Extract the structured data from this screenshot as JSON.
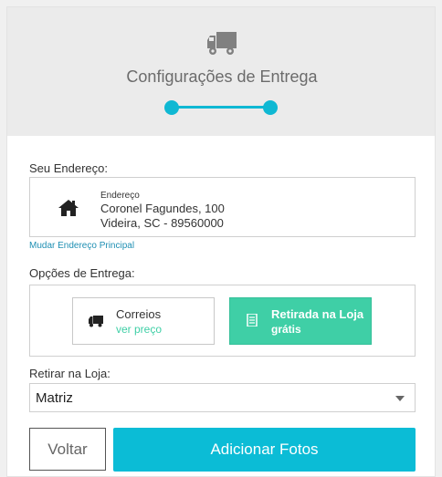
{
  "header": {
    "title": "Configurações de Entrega",
    "icon": "truck-icon",
    "step_color": "#0fb8d3"
  },
  "address": {
    "label": "Seu Endereço:",
    "caption": "Endereço",
    "line1": "Coronel Fagundes, 100",
    "line2": "Videira, SC - 89560000",
    "change_link": "Mudar Endereço Principal"
  },
  "delivery": {
    "label": "Opções de Entrega:",
    "options": [
      {
        "title": "Correios",
        "subtitle": "ver preço",
        "icon": "truck-icon",
        "selected": false
      },
      {
        "title": "Retirada na Loja",
        "subtitle": "grátis",
        "icon": "receipt-icon",
        "selected": true
      }
    ],
    "selected_color": "#3fcfa6"
  },
  "pickup": {
    "label": "Retirar na Loja:",
    "selected": "Matriz"
  },
  "actions": {
    "back_label": "Voltar",
    "add_label": "Adicionar Fotos",
    "primary_color": "#0bbcd6"
  }
}
